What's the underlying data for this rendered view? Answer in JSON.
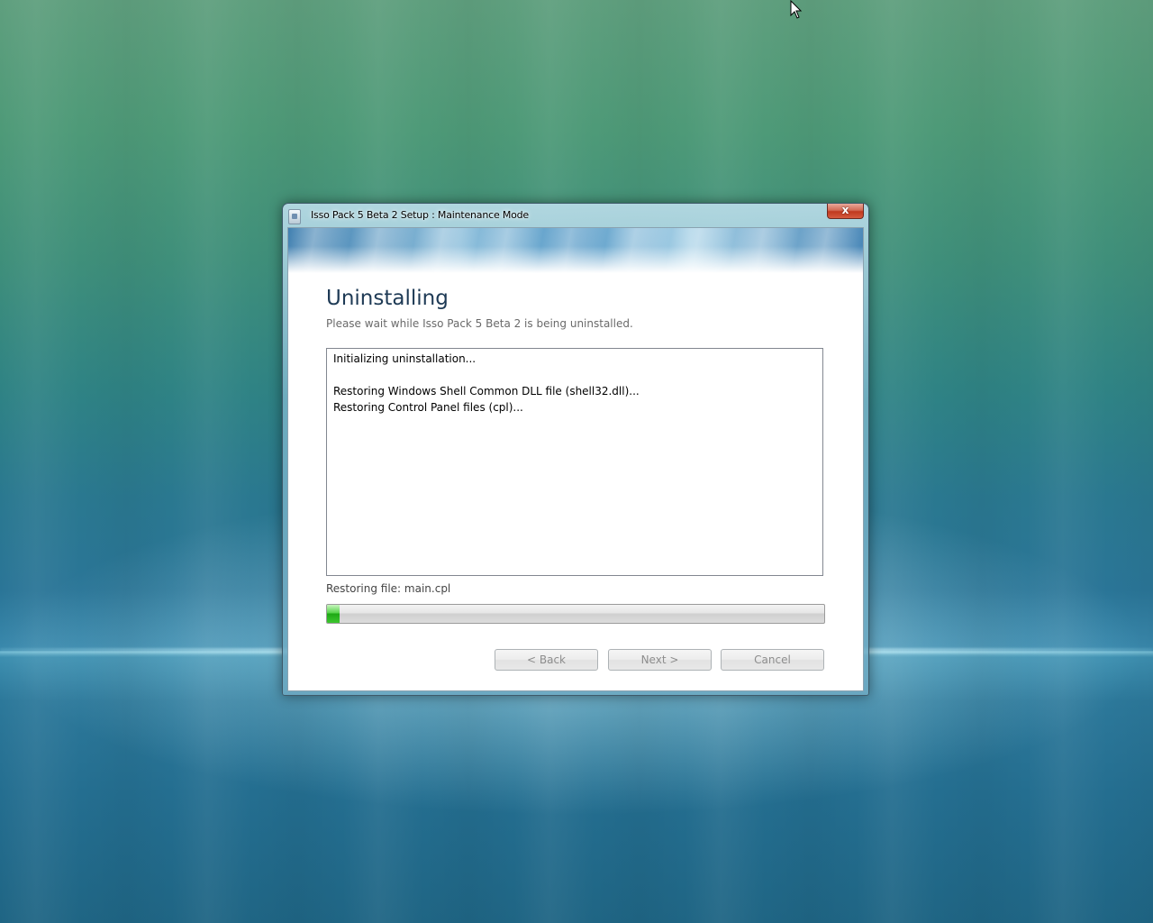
{
  "window": {
    "title": "Isso Pack 5 Beta 2 Setup : Maintenance Mode",
    "close_label": "x"
  },
  "page": {
    "heading": "Uninstalling",
    "subheading": "Please wait while Isso Pack 5 Beta 2 is being uninstalled."
  },
  "log": {
    "lines": [
      "Initializing uninstallation...",
      "",
      "Restoring Windows Shell Common DLL file (shell32.dll)...",
      "Restoring Control Panel files (cpl)..."
    ]
  },
  "status": {
    "text": "Restoring file: main.cpl"
  },
  "progress": {
    "fraction": 0.025,
    "fill_color": "#2fbf22"
  },
  "buttons": {
    "back_label": "< Back",
    "next_label": "Next >",
    "cancel_label": "Cancel",
    "back_enabled": false,
    "next_enabled": false,
    "cancel_enabled": false
  },
  "icons": {
    "title_icon": "setup-icon",
    "cursor": "mouse-pointer-icon"
  }
}
